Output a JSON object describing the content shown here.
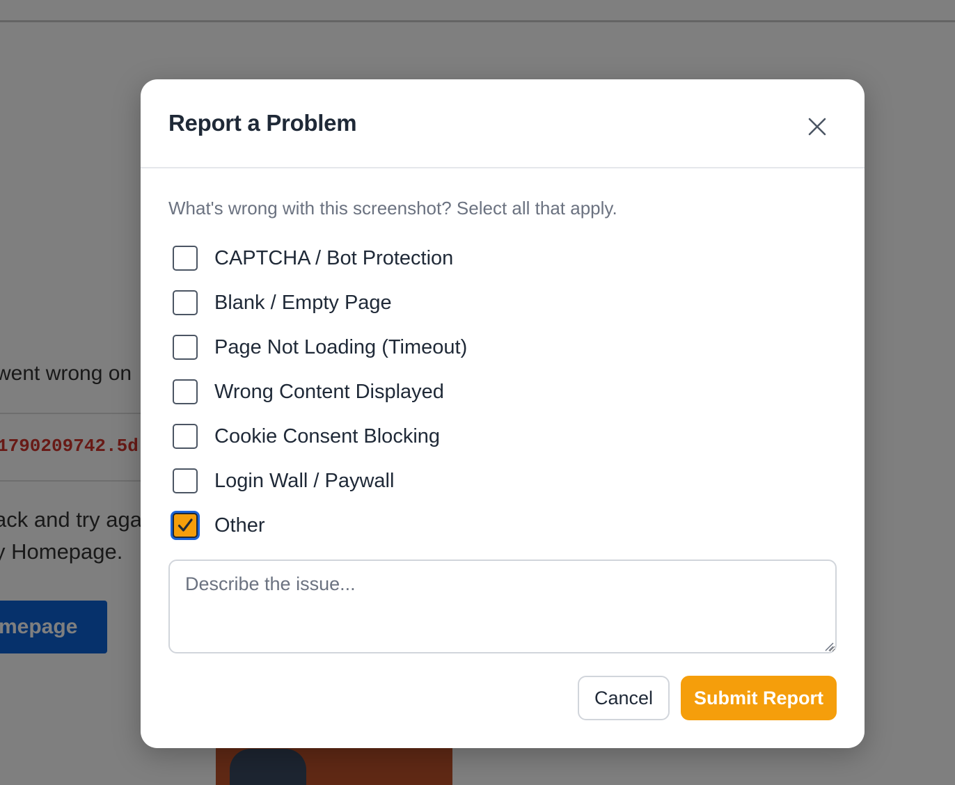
{
  "background_page": {
    "error_text_fragment": "went wrong on",
    "code_fragment": "1790209742.5d",
    "help_line_1": "ack and try aga",
    "help_line_2": "y Homepage.",
    "homepage_button_fragment": "mepage"
  },
  "modal": {
    "title": "Report a Problem",
    "close_icon": "close-icon",
    "prompt": "What's wrong with this screenshot? Select all that apply.",
    "options": [
      {
        "label": "CAPTCHA / Bot Protection",
        "checked": false
      },
      {
        "label": "Blank / Empty Page",
        "checked": false
      },
      {
        "label": "Page Not Loading (Timeout)",
        "checked": false
      },
      {
        "label": "Wrong Content Displayed",
        "checked": false
      },
      {
        "label": "Cookie Consent Blocking",
        "checked": false
      },
      {
        "label": "Login Wall / Paywall",
        "checked": false
      },
      {
        "label": "Other",
        "checked": true
      }
    ],
    "description": {
      "value": "",
      "placeholder": "Describe the issue..."
    },
    "cancel_label": "Cancel",
    "submit_label": "Submit Report"
  },
  "colors": {
    "accent": "#f59e0b",
    "focus_ring": "#1d64d6",
    "overlay": "rgba(0,0,0,0.5)",
    "background_button": "#0d63d6",
    "background_code": "#d0342c"
  }
}
